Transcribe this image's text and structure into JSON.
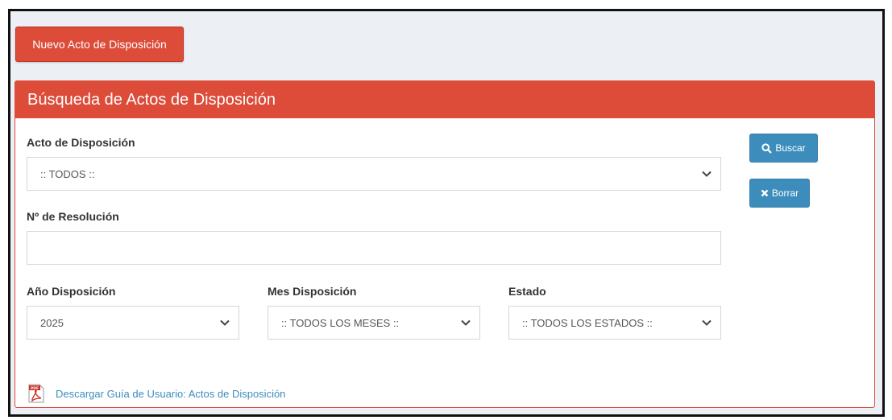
{
  "toolbar": {
    "new_button_label": "Nuevo Acto de Disposición"
  },
  "panel": {
    "title": "Búsqueda de Actos de Disposición",
    "acto": {
      "label": "Acto de Disposición",
      "selected": ":: TODOS ::"
    },
    "resolucion": {
      "label": "Nº de Resolución",
      "value": ""
    },
    "anio": {
      "label": "Año Disposición",
      "selected": "2025"
    },
    "mes": {
      "label": "Mes Disposición",
      "selected": ":: TODOS LOS MESES ::"
    },
    "estado": {
      "label": "Estado",
      "selected": ":: TODOS LOS ESTADOS ::"
    },
    "buscar_label": "Buscar",
    "borrar_label": "Borrar",
    "guide_link": "Descargar Guía de Usuario: Actos de Disposición"
  },
  "colors": {
    "danger": "#dd4b39",
    "primary": "#3c8dbc",
    "background": "#ecf0f5"
  },
  "icons": {
    "buscar": "search-icon",
    "borrar": "times-icon",
    "select": "chevron-down-icon",
    "guide": "pdf-file-icon"
  }
}
